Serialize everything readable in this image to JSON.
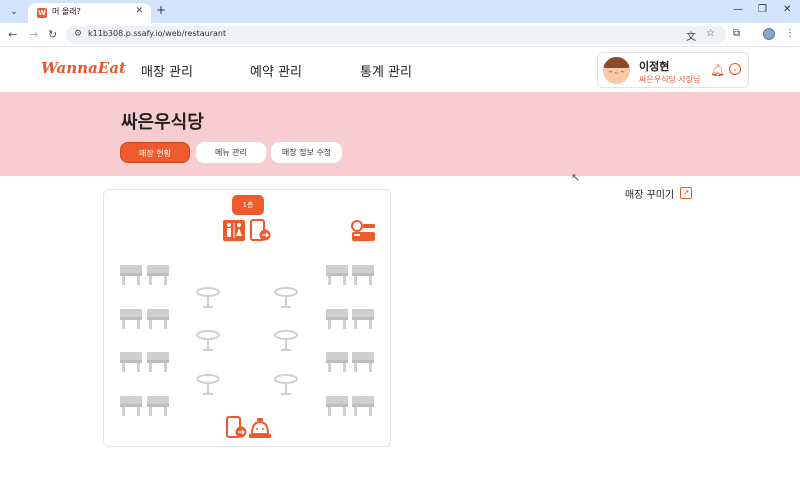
{
  "browser": {
    "tab_title": "머 올래?",
    "tab_favicon": "W",
    "url": "k11b308.p.ssafy.io/web/restaurant",
    "icons": [
      "tab-list-icon",
      "close-icon",
      "new-tab-icon",
      "minimize-icon",
      "restore-icon",
      "close-window-icon",
      "back-icon",
      "forward-icon",
      "reload-icon",
      "site-info-icon",
      "translate-icon",
      "bookmark-star-icon",
      "extensions-icon",
      "profile-icon",
      "menu-icon"
    ]
  },
  "header": {
    "logo": "WannaEat",
    "nav": [
      "매장 관리",
      "예약 관리",
      "통계 관리"
    ],
    "user_name": "이정현",
    "user_role": "싸은우식당 사장님"
  },
  "store": {
    "title": "싸은우식당",
    "tabs": [
      {
        "label": "매장 현황",
        "active": true
      },
      {
        "label": "메뉴 관리",
        "active": false
      },
      {
        "label": "매장 정보 수정",
        "active": false
      }
    ]
  },
  "floor_map": {
    "floor_label": "1층",
    "icons": [
      "restroom-icon",
      "exit-door-icon",
      "counter-icon",
      "entrance-door-icon",
      "reception-bell-icon"
    ]
  },
  "decorate": {
    "label": "매장 꾸미기"
  },
  "colors": {
    "accent": "#ef5a2d",
    "hero_bg": "#f8cdd1",
    "chrome_bg": "#d3e3fd",
    "table_gray": "#cfcfcf"
  }
}
